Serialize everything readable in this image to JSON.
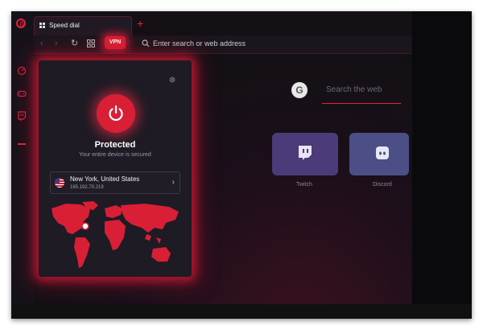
{
  "tab": {
    "title": "Speed dial",
    "new_tab_symbol": "+"
  },
  "toolbar": {
    "back_symbol": "‹",
    "forward_symbol": "›",
    "reload_symbol": "↻",
    "vpn_badge_label": "VPN",
    "address_placeholder": "Enter search or web address"
  },
  "vpn_panel": {
    "status_title": "Protected",
    "status_subtitle": "Your entire device is secured",
    "location_city": "New York, United States",
    "location_ip": "185.192.70.219",
    "chevron_symbol": "›"
  },
  "speed_dial": {
    "search_placeholder": "Search the web",
    "google_letter": "G",
    "tiles": [
      {
        "label": "Twitch",
        "icon": "twitch-icon"
      },
      {
        "label": "Discord",
        "icon": "discord-icon"
      }
    ]
  },
  "sidebar_icons": [
    "opera-logo-icon",
    "speedometer-icon",
    "controller-icon",
    "twitch-icon"
  ],
  "colors": {
    "accent": "#e2233d",
    "panel": "#1e1b24",
    "background": "#121014"
  }
}
